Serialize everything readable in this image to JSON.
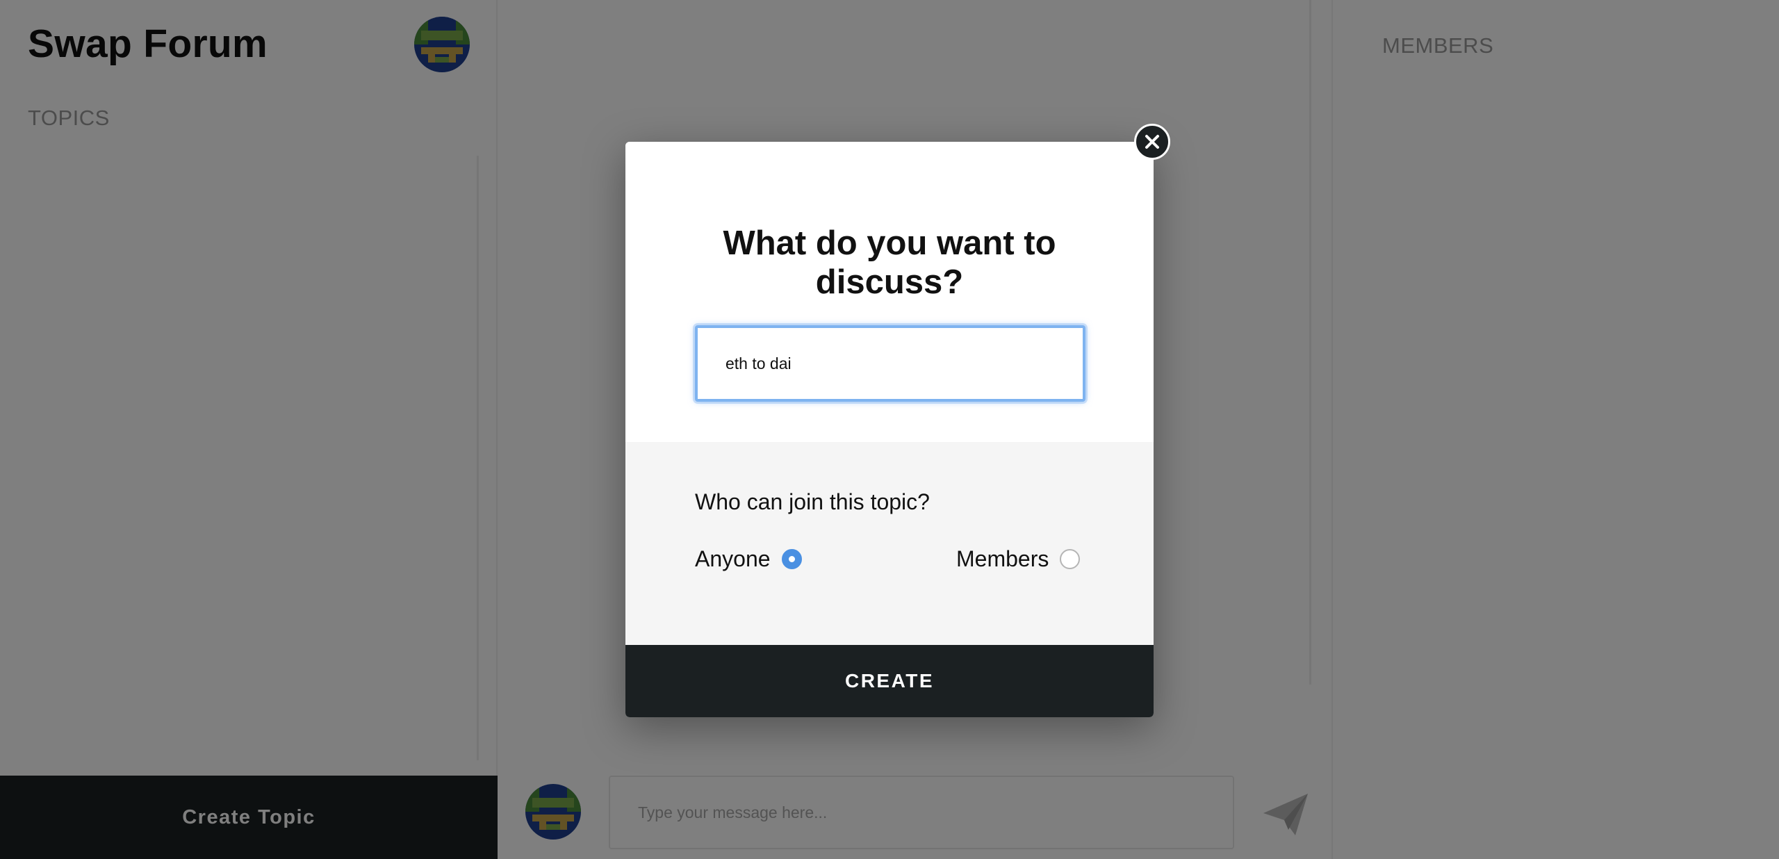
{
  "app": {
    "title": "Swap Forum"
  },
  "sidebar": {
    "topics_label": "TOPICS",
    "create_topic_label": "Create Topic",
    "avatar_icon": "pixel-avatar-icon"
  },
  "main": {
    "composer": {
      "placeholder": "Type your message here...",
      "send_icon": "paper-plane-send-icon"
    }
  },
  "members_panel": {
    "label": "MEMBERS"
  },
  "modal": {
    "title": "What do you want to discuss?",
    "topic_input_value": "eth to dai",
    "join_question": "Who can join this topic?",
    "options": [
      {
        "label": "Anyone",
        "selected": true
      },
      {
        "label": "Members",
        "selected": false
      }
    ],
    "create_label": "CREATE",
    "close_icon": "close-x-icon"
  },
  "colors": {
    "dark": "#1b2022",
    "accent": "#4a90e2",
    "focus": "#7eb3f0",
    "muted": "#999999"
  }
}
